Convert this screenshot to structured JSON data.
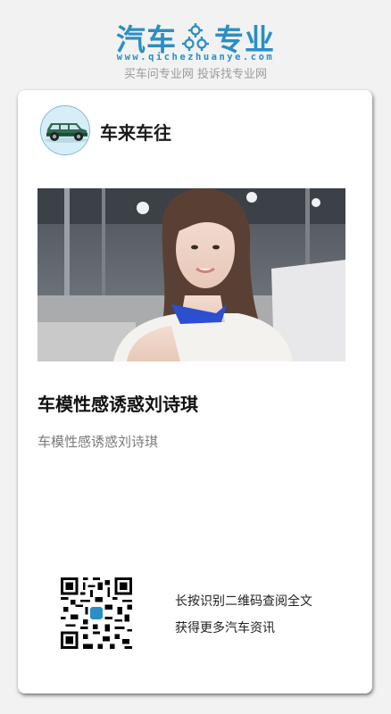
{
  "brand": {
    "name_left": "汽车",
    "name_right": "专业",
    "url": "www.qichezhuanye.com",
    "slogan": "买车问专业网 投诉找专业网",
    "color": "#2a8fc4",
    "icon": "gear-icon"
  },
  "card": {
    "author": "车来车往",
    "avatar_icon": "car-icon",
    "title": "车模性感诱惑刘诗琪",
    "summary": "车模性感诱惑刘诗琪"
  },
  "qr": {
    "line1": "长按识别二维码查阅全文",
    "line2": "获得更多汽车资讯"
  }
}
